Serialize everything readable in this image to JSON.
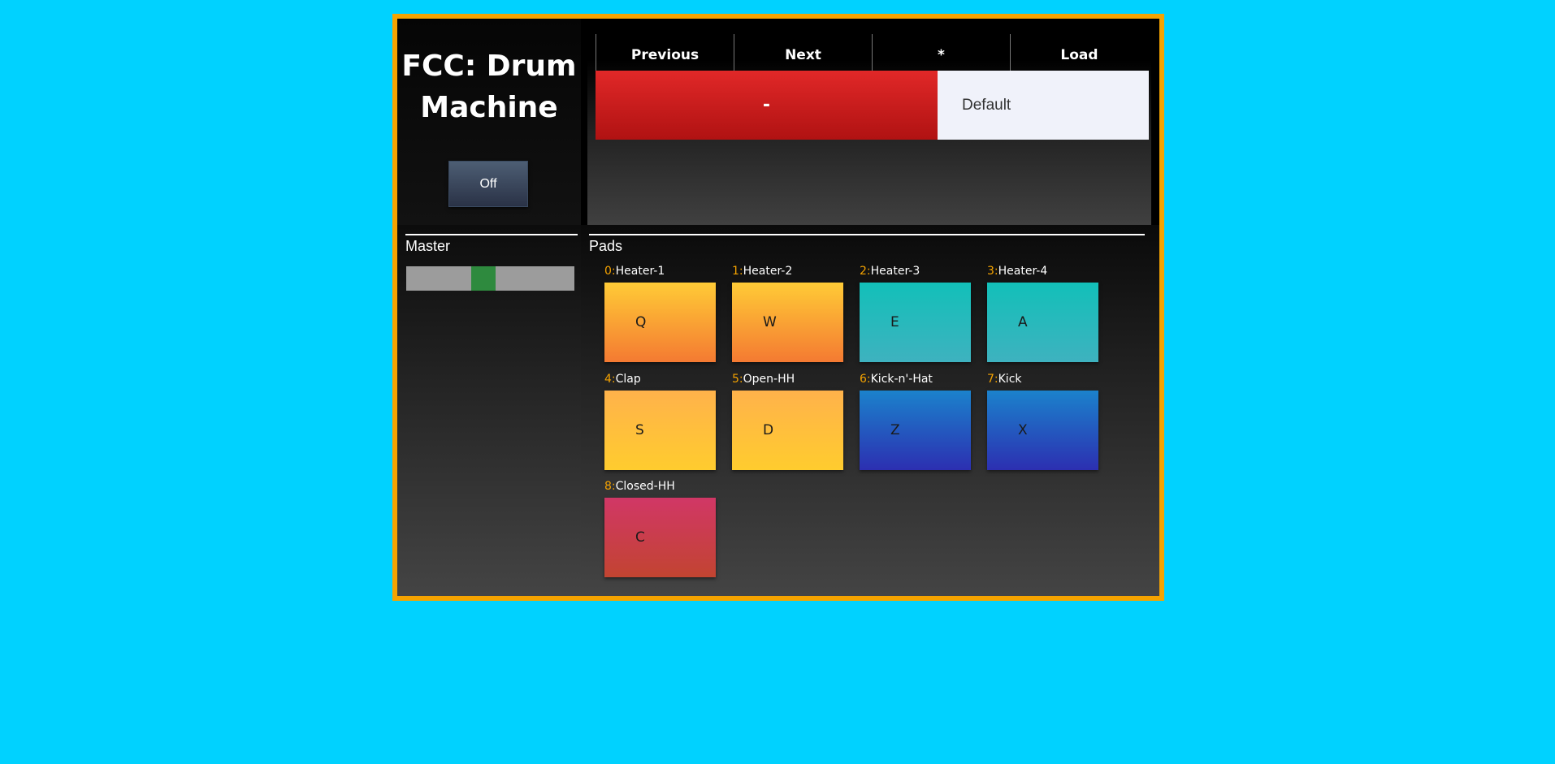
{
  "app": {
    "title": "FCC: Drum Machine",
    "colors": {
      "page_background": "#00d2ff",
      "frame_border": "#f5a300",
      "index_accent": "#f5a300"
    }
  },
  "power": {
    "label": "Off"
  },
  "master": {
    "label": "Master",
    "volume_fraction": 0.45
  },
  "nav": {
    "previous": "Previous",
    "next": "Next",
    "star": "*",
    "load": "Load"
  },
  "kit": {
    "toggle_label": "-",
    "name": "Default"
  },
  "pads": {
    "label": "Pads",
    "items": [
      {
        "index": "0:",
        "name": "Heater-1",
        "key": "Q",
        "color": "orange"
      },
      {
        "index": "1:",
        "name": "Heater-2",
        "key": "W",
        "color": "orange"
      },
      {
        "index": "2:",
        "name": "Heater-3",
        "key": "E",
        "color": "teal"
      },
      {
        "index": "3:",
        "name": "Heater-4",
        "key": "A",
        "color": "teal"
      },
      {
        "index": "4:",
        "name": "Clap",
        "key": "S",
        "color": "yellow"
      },
      {
        "index": "5:",
        "name": "Open-HH",
        "key": "D",
        "color": "yellow"
      },
      {
        "index": "6:",
        "name": "Kick-n'-Hat",
        "key": "Z",
        "color": "blue"
      },
      {
        "index": "7:",
        "name": "Kick",
        "key": "X",
        "color": "blue"
      },
      {
        "index": "8:",
        "name": "Closed-HH",
        "key": "C",
        "color": "pink"
      }
    ]
  }
}
